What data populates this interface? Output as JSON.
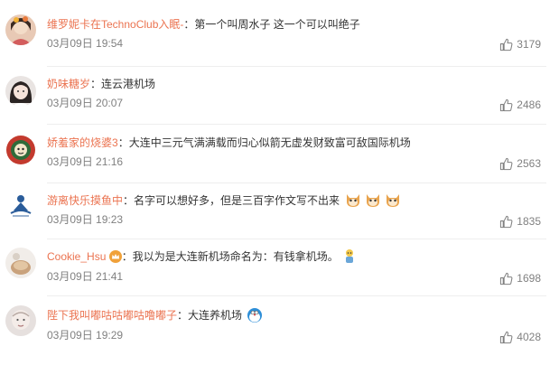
{
  "comments": [
    {
      "username": "维罗妮卡在TechnoClub入眠-",
      "text": "第一个叫周水子 这一个可以叫绝子",
      "time": "03月09日 19:54",
      "likes": "3179"
    },
    {
      "username": "奶味糖岁",
      "text": "连云港机场",
      "time": "03月09日 20:07",
      "likes": "2486"
    },
    {
      "username": "娇羞家的烧婆3",
      "text": "大连中三元气满满载而归心似箭无虚发财致富可敌国际机场",
      "time": "03月09日 21:16",
      "likes": "2563"
    },
    {
      "username": "游离快乐摸鱼中",
      "text": "名字可以想好多，但是三百字作文写不出来",
      "time": "03月09日 19:23",
      "likes": "1835"
    },
    {
      "username": "Cookie_Hsu",
      "text": "我以为是大连新机场命名为：有钱拿机场。",
      "time": "03月09日 21:41",
      "likes": "1698"
    },
    {
      "username": "陛下我叫嘟咕咕嘟咕噜嘟子",
      "text": "大连养机场",
      "time": "03月09日 19:29",
      "likes": "4028"
    }
  ],
  "separator": "：",
  "icons": {
    "like": "thumbs-up-icon",
    "badge": "vip-crown-icon",
    "emoji_cat": "cat-face-emoji",
    "emoji_person": "little-person-emoji",
    "emoji_doraemon": "doraemon-emoji"
  },
  "colors": {
    "username": "#eb7350",
    "text": "#333333",
    "meta": "#808080",
    "divider": "#eeeeee"
  }
}
